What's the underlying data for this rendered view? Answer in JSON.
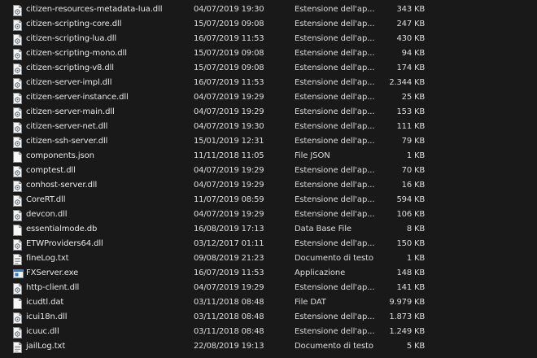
{
  "files": [
    {
      "name": "citizen-resources-metadata-lua.dll",
      "modified": "04/07/2019 19:30",
      "type": "Estensione dell'ap...",
      "size": "343 KB",
      "icon": "dll-file-icon"
    },
    {
      "name": "citizen-scripting-core.dll",
      "modified": "15/07/2019 09:08",
      "type": "Estensione dell'ap...",
      "size": "247 KB",
      "icon": "dll-file-icon"
    },
    {
      "name": "citizen-scripting-lua.dll",
      "modified": "16/07/2019 11:53",
      "type": "Estensione dell'ap...",
      "size": "430 KB",
      "icon": "dll-file-icon"
    },
    {
      "name": "citizen-scripting-mono.dll",
      "modified": "15/07/2019 09:08",
      "type": "Estensione dell'ap...",
      "size": "94 KB",
      "icon": "dll-file-icon"
    },
    {
      "name": "citizen-scripting-v8.dll",
      "modified": "15/07/2019 09:08",
      "type": "Estensione dell'ap...",
      "size": "174 KB",
      "icon": "dll-file-icon"
    },
    {
      "name": "citizen-server-impl.dll",
      "modified": "16/07/2019 11:53",
      "type": "Estensione dell'ap...",
      "size": "2.344 KB",
      "icon": "dll-file-icon"
    },
    {
      "name": "citizen-server-instance.dll",
      "modified": "04/07/2019 19:29",
      "type": "Estensione dell'ap...",
      "size": "25 KB",
      "icon": "dll-file-icon"
    },
    {
      "name": "citizen-server-main.dll",
      "modified": "04/07/2019 19:29",
      "type": "Estensione dell'ap...",
      "size": "153 KB",
      "icon": "dll-file-icon"
    },
    {
      "name": "citizen-server-net.dll",
      "modified": "04/07/2019 19:30",
      "type": "Estensione dell'ap...",
      "size": "111 KB",
      "icon": "dll-file-icon"
    },
    {
      "name": "citizen-ssh-server.dll",
      "modified": "15/01/2019 12:31",
      "type": "Estensione dell'ap...",
      "size": "79 KB",
      "icon": "dll-file-icon"
    },
    {
      "name": "components.json",
      "modified": "11/11/2018 11:05",
      "type": "File JSON",
      "size": "1 KB",
      "icon": "blank-file-icon"
    },
    {
      "name": "comptest.dll",
      "modified": "04/07/2019 19:29",
      "type": "Estensione dell'ap...",
      "size": "70 KB",
      "icon": "dll-file-icon"
    },
    {
      "name": "conhost-server.dll",
      "modified": "04/07/2019 19:29",
      "type": "Estensione dell'ap...",
      "size": "16 KB",
      "icon": "dll-file-icon"
    },
    {
      "name": "CoreRT.dll",
      "modified": "11/07/2019 08:59",
      "type": "Estensione dell'ap...",
      "size": "594 KB",
      "icon": "dll-file-icon"
    },
    {
      "name": "devcon.dll",
      "modified": "04/07/2019 19:29",
      "type": "Estensione dell'ap...",
      "size": "106 KB",
      "icon": "dll-file-icon"
    },
    {
      "name": "essentialmode.db",
      "modified": "16/08/2019 17:13",
      "type": "Data Base File",
      "size": "8 KB",
      "icon": "blank-file-icon"
    },
    {
      "name": "ETWProviders64.dll",
      "modified": "03/12/2017 01:11",
      "type": "Estensione dell'ap...",
      "size": "150 KB",
      "icon": "dll-file-icon"
    },
    {
      "name": "fineLog.txt",
      "modified": "09/08/2019 21:23",
      "type": "Documento di testo",
      "size": "1 KB",
      "icon": "text-file-icon"
    },
    {
      "name": "FXServer.exe",
      "modified": "16/07/2019 11:53",
      "type": "Applicazione",
      "size": "148 KB",
      "icon": "exe-file-icon"
    },
    {
      "name": "http-client.dll",
      "modified": "04/07/2019 19:29",
      "type": "Estensione dell'ap...",
      "size": "141 KB",
      "icon": "dll-file-icon"
    },
    {
      "name": "icudtl.dat",
      "modified": "03/11/2018 08:48",
      "type": "File DAT",
      "size": "9.979 KB",
      "icon": "blank-file-icon"
    },
    {
      "name": "icui18n.dll",
      "modified": "03/11/2018 08:48",
      "type": "Estensione dell'ap...",
      "size": "1.873 KB",
      "icon": "dll-file-icon"
    },
    {
      "name": "icuuc.dll",
      "modified": "03/11/2018 08:48",
      "type": "Estensione dell'ap...",
      "size": "1.249 KB",
      "icon": "dll-file-icon"
    },
    {
      "name": "jailLog.txt",
      "modified": "22/08/2019 19:13",
      "type": "Documento di testo",
      "size": "5 KB",
      "icon": "text-file-icon"
    }
  ]
}
